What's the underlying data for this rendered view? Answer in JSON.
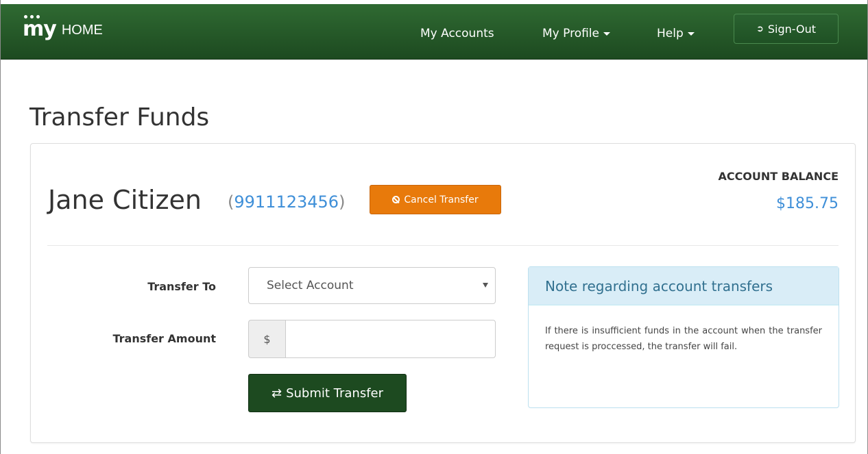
{
  "navbar": {
    "brand_logo": "my",
    "brand_home": "HOME",
    "items": [
      {
        "label": "My Accounts"
      },
      {
        "label": "My Profile"
      },
      {
        "label": "Help"
      }
    ],
    "signout_label": "Sign-Out",
    "signout_icon": "sign-out-icon"
  },
  "page": {
    "title": "Transfer Funds"
  },
  "account": {
    "holder_name": "Jane Citizen",
    "number_open": "(",
    "number": "9911123456",
    "number_close": ")",
    "cancel_label": "Cancel Transfer",
    "balance_label": "ACCOUNT BALANCE",
    "balance_value": "$185.75"
  },
  "form": {
    "transfer_to_label": "Transfer To",
    "select_value": "Select Account",
    "amount_label": "Transfer Amount",
    "currency_addon": "$",
    "amount_value": "",
    "submit_label": "Submit Transfer"
  },
  "note": {
    "title": "Note regarding account transfers",
    "body": "If there is insufficient funds in the account when the transfer request is proccessed, the transfer will fail."
  },
  "colors": {
    "navbar": "#1d4a20",
    "accent_orange": "#e87a0b",
    "link_blue": "#3f8fd8",
    "info_header": "#d9edf7"
  }
}
